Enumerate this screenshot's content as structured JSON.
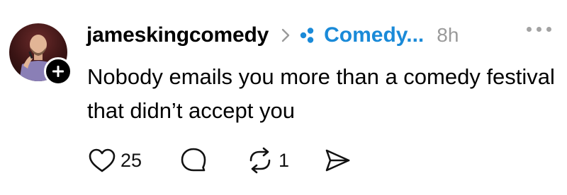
{
  "post": {
    "username": "jameskingcomedy",
    "community": "Comedy...",
    "time": "8h",
    "text": "Nobody emails you more than a comedy festival that didn’t accept you",
    "likes": "25",
    "reposts": "1"
  },
  "icons": {
    "avatar": "user-avatar",
    "follow": "plus-icon",
    "chevron": "chevron-right-icon",
    "community": "community-icon",
    "more": "more-icon",
    "like": "heart-icon",
    "reply": "reply-icon",
    "repost": "repost-icon",
    "share": "share-icon"
  },
  "colors": {
    "community": "#1a8ad8",
    "meta": "#9a9a9a"
  }
}
